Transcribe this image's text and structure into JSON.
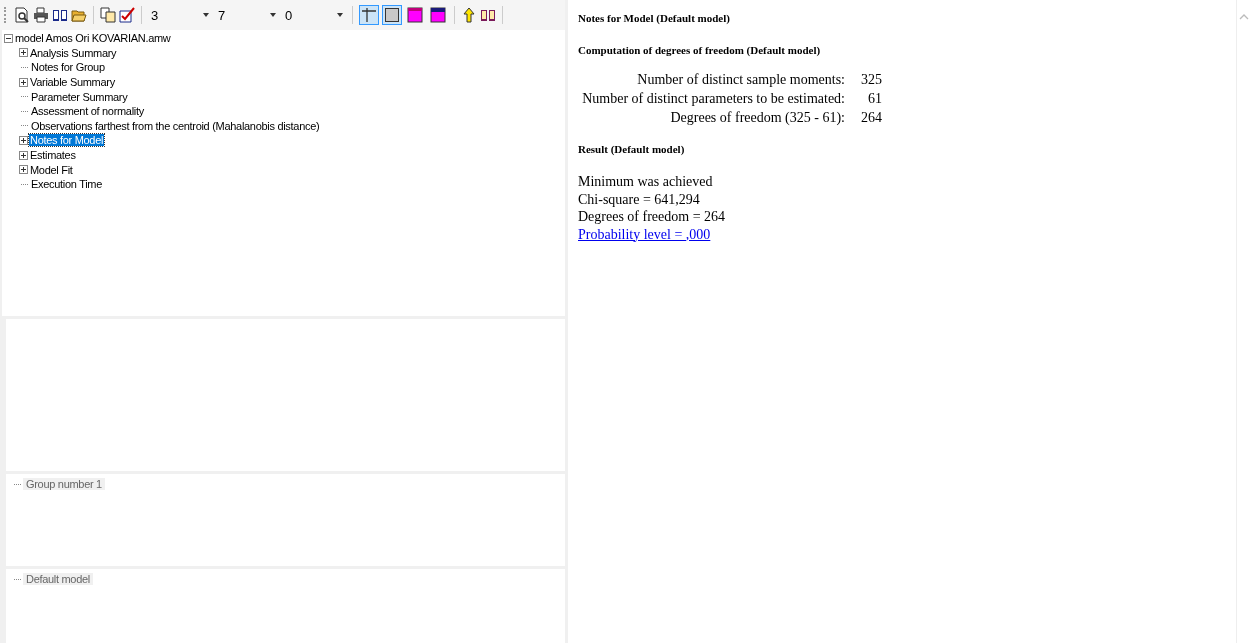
{
  "toolbar": {
    "tools": [
      {
        "kind": "preview"
      },
      {
        "kind": "print"
      },
      {
        "kind": "book"
      },
      {
        "kind": "folder"
      },
      {
        "kind": "sep"
      },
      {
        "kind": "copy"
      },
      {
        "kind": "check"
      },
      {
        "kind": "sep"
      }
    ],
    "dropdowns": [
      {
        "value": "3"
      },
      {
        "value": "7"
      },
      {
        "value": "0"
      }
    ],
    "toggles": [
      {
        "kind": "cross",
        "selected": true
      },
      {
        "kind": "box",
        "selected": true
      },
      {
        "kind": "magenta-top",
        "selected": false
      },
      {
        "kind": "magenta-navy",
        "selected": false
      }
    ],
    "extras": [
      {
        "kind": "arrow"
      },
      {
        "kind": "book"
      }
    ]
  },
  "tree": {
    "label": "model Amos Ori KOVARIAN.amw",
    "expanded": true,
    "children": [
      {
        "label": "Analysis Summary",
        "kind": "branch",
        "selected": false
      },
      {
        "label": "Notes for Group",
        "kind": "leaf",
        "selected": false
      },
      {
        "label": "Variable Summary",
        "kind": "branch",
        "selected": false
      },
      {
        "label": "Parameter Summary",
        "kind": "leaf",
        "selected": false
      },
      {
        "label": "Assessment of normality",
        "kind": "leaf",
        "selected": false
      },
      {
        "label": "Observations farthest from the centroid (Mahalanobis distance)",
        "kind": "leaf",
        "selected": false
      },
      {
        "label": "Notes for Model",
        "kind": "branch",
        "selected": true
      },
      {
        "label": "Estimates",
        "kind": "branch",
        "selected": false
      },
      {
        "label": "Model Fit",
        "kind": "branch",
        "selected": false
      },
      {
        "label": "Execution Time",
        "kind": "leaf",
        "selected": false
      }
    ]
  },
  "groups": [
    {
      "label": "Group number 1"
    }
  ],
  "models": [
    {
      "label": "Default model"
    }
  ],
  "output": {
    "title": "Notes for Model (Default model)",
    "section": "Computation of degrees of freedom (Default model)",
    "rows": [
      {
        "label": "Number of distinct sample moments:",
        "value": "325"
      },
      {
        "label": "Number of distinct parameters to be estimated:",
        "value": "61"
      },
      {
        "label": "Degrees of freedom (325 - 61):",
        "value": "264"
      }
    ],
    "result_title": "Result (Default model)",
    "result_lines": [
      "Minimum was achieved",
      "Chi-square = 641,294",
      "Degrees of freedom = 264"
    ],
    "result_link": "Probability level = ,000"
  }
}
